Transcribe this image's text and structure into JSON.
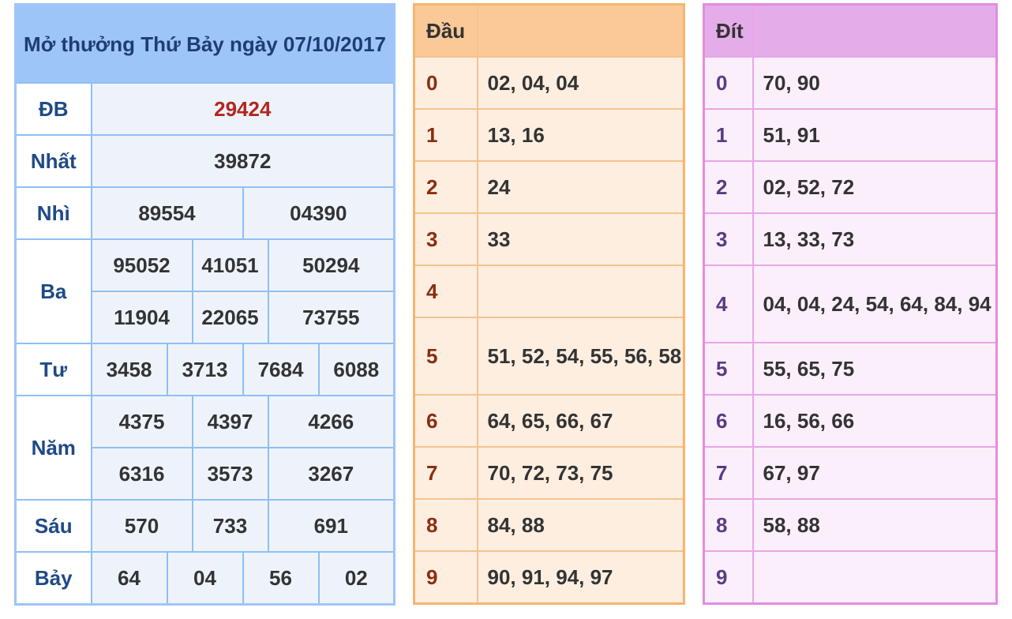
{
  "results": {
    "title": "Mở thưởng Thứ Bảy ngày 07/10/2017",
    "labels": {
      "db": "ĐB",
      "nhat": "Nhất",
      "nhi": "Nhì",
      "ba": "Ba",
      "tu": "Tư",
      "nam": "Năm",
      "sau": "Sáu",
      "bay": "Bảy"
    },
    "db": "29424",
    "nhat": "39872",
    "nhi": [
      "89554",
      "04390"
    ],
    "ba": [
      "95052",
      "41051",
      "50294",
      "11904",
      "22065",
      "73755"
    ],
    "tu": [
      "3458",
      "3713",
      "7684",
      "6088"
    ],
    "nam": [
      "4375",
      "4397",
      "4266",
      "6316",
      "3573",
      "3267"
    ],
    "sau": [
      "570",
      "733",
      "691"
    ],
    "bay": [
      "64",
      "04",
      "56",
      "02"
    ]
  },
  "dau": {
    "header": "Đầu",
    "rows": [
      {
        "k": "0",
        "v": "02, 04, 04"
      },
      {
        "k": "1",
        "v": "13, 16"
      },
      {
        "k": "2",
        "v": "24"
      },
      {
        "k": "3",
        "v": "33"
      },
      {
        "k": "4",
        "v": ""
      },
      {
        "k": "5",
        "v": "51, 52, 54, 55, 56, 58"
      },
      {
        "k": "6",
        "v": "64, 65, 66, 67"
      },
      {
        "k": "7",
        "v": "70, 72, 73, 75"
      },
      {
        "k": "8",
        "v": "84, 88"
      },
      {
        "k": "9",
        "v": "90, 91, 94, 97"
      }
    ]
  },
  "dit": {
    "header": "Đít",
    "rows": [
      {
        "k": "0",
        "v": "70, 90"
      },
      {
        "k": "1",
        "v": "51, 91"
      },
      {
        "k": "2",
        "v": "02, 52, 72"
      },
      {
        "k": "3",
        "v": "13, 33, 73"
      },
      {
        "k": "4",
        "v": "04, 04, 24, 54, 64, 84, 94"
      },
      {
        "k": "5",
        "v": "55, 65, 75"
      },
      {
        "k": "6",
        "v": "16, 56, 66"
      },
      {
        "k": "7",
        "v": "67, 97"
      },
      {
        "k": "8",
        "v": "58, 88"
      },
      {
        "k": "9",
        "v": ""
      }
    ]
  },
  "colors": {
    "blue_border": "#9ec5f8",
    "db_red": "#b3261e",
    "orange_border": "#f7b570",
    "pink_border": "#e28de0"
  }
}
